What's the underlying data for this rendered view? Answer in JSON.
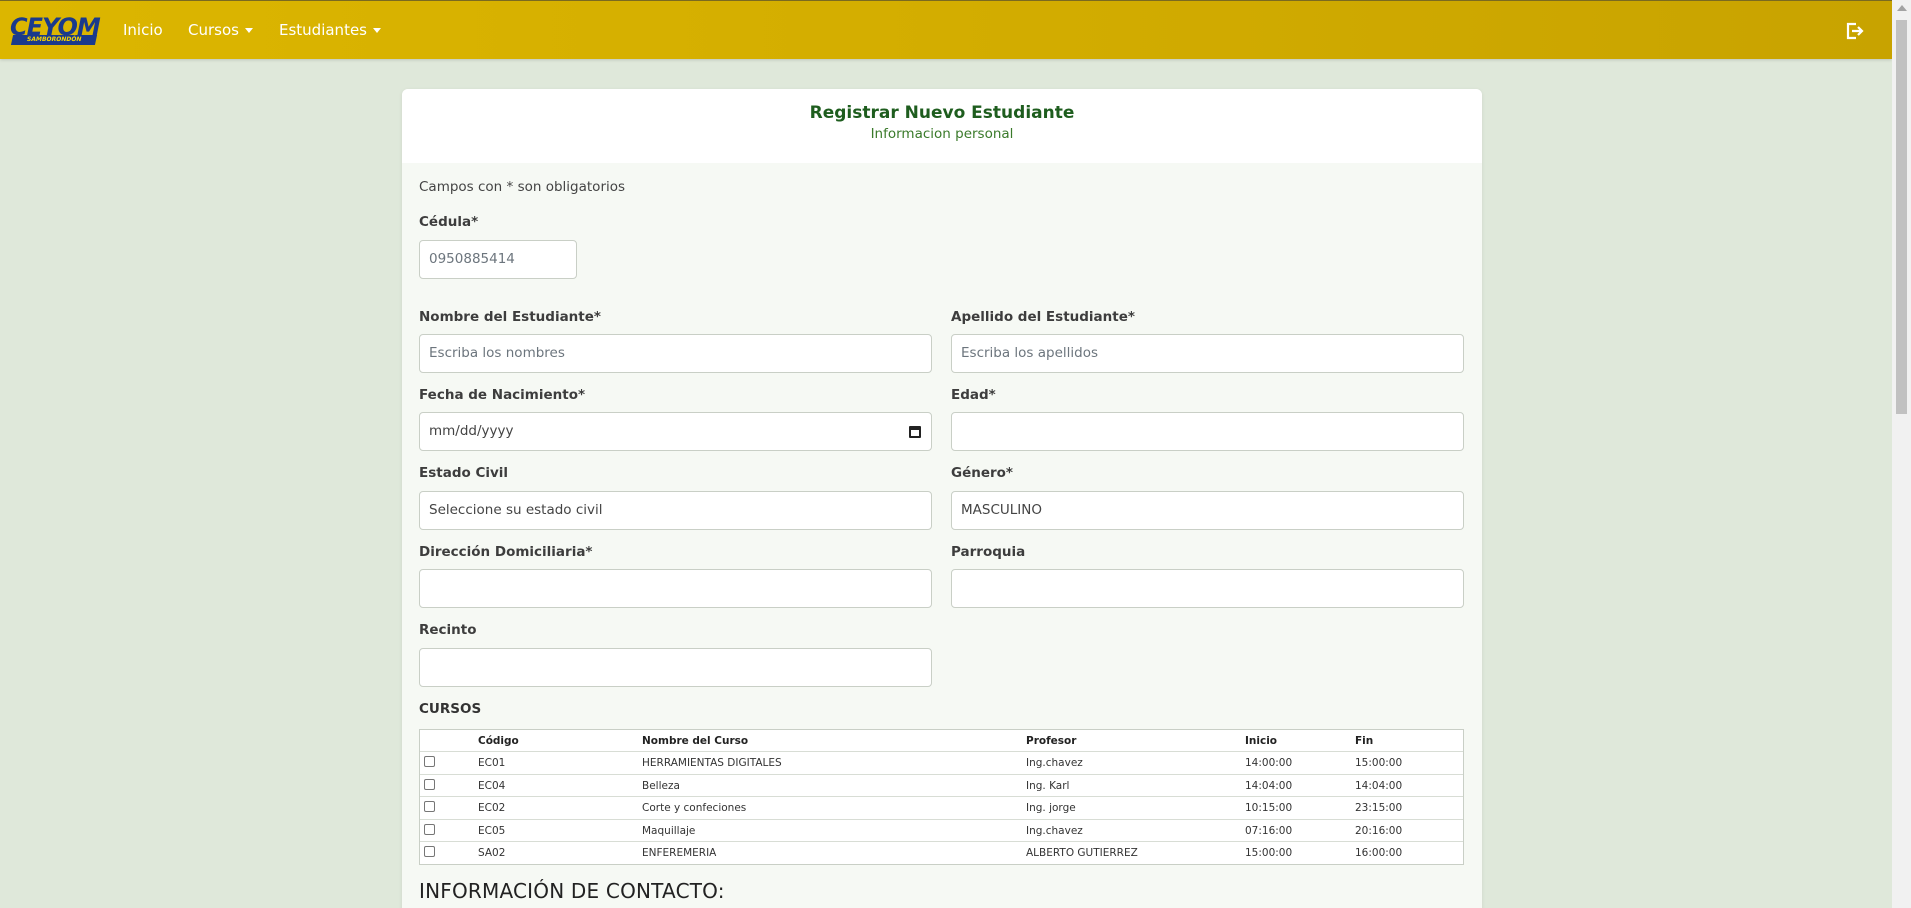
{
  "navbar": {
    "logo_text": "CEYOM",
    "logo_subtext": "SAMBORONDÓN",
    "items": [
      {
        "label": "Inicio",
        "dropdown": false
      },
      {
        "label": "Cursos",
        "dropdown": true
      },
      {
        "label": "Estudiantes",
        "dropdown": true
      }
    ],
    "logout_icon": "logout-icon",
    "brand_color": "#D4AF00"
  },
  "form": {
    "title": "Registrar Nuevo Estudiante",
    "subtitle": "Informacion personal",
    "note": "Campos con * son obligatorios",
    "cedula": {
      "label": "Cédula*",
      "value": "0950885414"
    },
    "nombre": {
      "label": "Nombre del Estudiante*",
      "placeholder": "Escriba los nombres"
    },
    "apellido": {
      "label": "Apellido del Estudiante*",
      "placeholder": "Escriba los apellidos"
    },
    "fecha": {
      "label": "Fecha de Nacimiento*",
      "placeholder": "mm/dd/yyyy"
    },
    "edad": {
      "label": "Edad*",
      "value": ""
    },
    "estado_civil": {
      "label": "Estado Civil",
      "value": "Seleccione su estado civil"
    },
    "genero": {
      "label": "Género*",
      "value": "MASCULINO"
    },
    "direccion": {
      "label": "Dirección Domiciliaria*",
      "value": ""
    },
    "parroquia": {
      "label": "Parroquia",
      "value": ""
    },
    "recinto": {
      "label": "Recinto",
      "value": ""
    },
    "cursos_title": "CURSOS",
    "contact_title": "INFORMACIÓN DE CONTACTO:"
  },
  "courses": {
    "headers": [
      "Código",
      "Nombre del Curso",
      "Profesor",
      "Inicio",
      "Fin"
    ],
    "rows": [
      {
        "codigo": "EC01",
        "nombre": "HERRAMIENTAS DIGITALES",
        "profesor": "Ing.chavez",
        "inicio": "14:00:00",
        "fin": "15:00:00",
        "checked": false
      },
      {
        "codigo": "EC04",
        "nombre": "Belleza",
        "profesor": "Ing. Karl",
        "inicio": "14:04:00",
        "fin": "14:04:00",
        "checked": false
      },
      {
        "codigo": "EC02",
        "nombre": "Corte y confeciones",
        "profesor": "Ing. jorge",
        "inicio": "10:15:00",
        "fin": "23:15:00",
        "checked": false
      },
      {
        "codigo": "EC05",
        "nombre": "Maquillaje",
        "profesor": "Ing.chavez",
        "inicio": "07:16:00",
        "fin": "20:16:00",
        "checked": false
      },
      {
        "codigo": "SA02",
        "nombre": "ENFEREMERIA",
        "profesor": "ALBERTO GUTIERREZ",
        "inicio": "15:00:00",
        "fin": "16:00:00",
        "checked": false
      }
    ]
  }
}
